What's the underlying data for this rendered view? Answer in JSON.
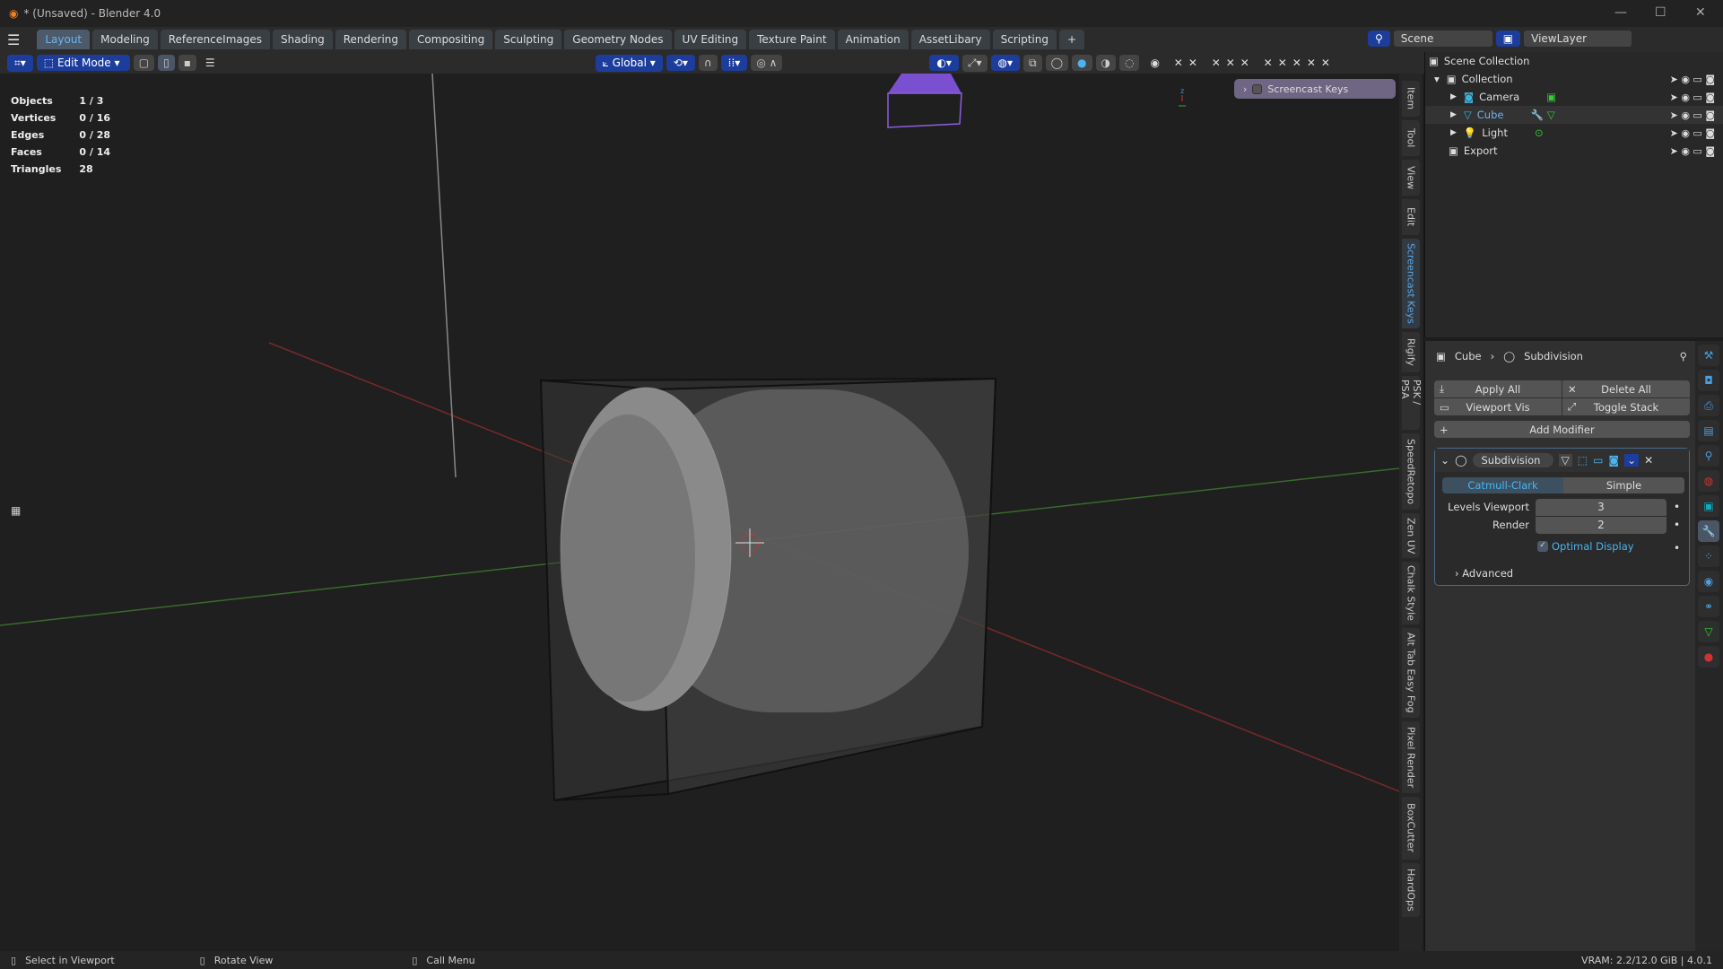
{
  "window": {
    "title": "* (Unsaved) - Blender 4.0",
    "controls": [
      "—",
      "☐",
      "✕"
    ]
  },
  "workspaces": {
    "tabs": [
      "Layout",
      "Modeling",
      "ReferenceImages",
      "Shading",
      "Rendering",
      "Compositing",
      "Sculpting",
      "Geometry Nodes",
      "UV Editing",
      "Texture Paint",
      "Animation",
      "AssetLibary",
      "Scripting"
    ],
    "active": "Layout",
    "add": "+"
  },
  "scene": {
    "scene_name": "Scene",
    "view_layer": "ViewLayer"
  },
  "viewport_header": {
    "mode": "Edit Mode",
    "transform_orientation": "Global"
  },
  "stats": [
    {
      "label": "Objects",
      "value": "1 / 3"
    },
    {
      "label": "Vertices",
      "value": "0 / 16"
    },
    {
      "label": "Edges",
      "value": "0 / 28"
    },
    {
      "label": "Faces",
      "value": "0 / 14"
    },
    {
      "label": "Triangles",
      "value": "28"
    }
  ],
  "screencast_keys": {
    "label": "Screencast Keys"
  },
  "side_tabs": [
    "Item",
    "Tool",
    "View",
    "Edit",
    "Screencast Keys",
    "Rigify",
    "PSK / PSA",
    "SpeedRetopo",
    "Zen UV",
    "Chalk Style",
    "Alt Tab Easy Fog",
    "Pixel Render",
    "BoxCutter",
    "HardOps"
  ],
  "side_tab_active": "Screencast Keys",
  "outliner": {
    "root": "Scene Collection",
    "items": [
      {
        "name": "Collection",
        "type": "collection"
      },
      {
        "name": "Camera",
        "type": "camera"
      },
      {
        "name": "Cube",
        "type": "mesh",
        "selected": true
      },
      {
        "name": "Light",
        "type": "light"
      },
      {
        "name": "Export",
        "type": "collection"
      }
    ]
  },
  "properties": {
    "breadcrumb": {
      "object": "Cube",
      "modifier": "Subdivision"
    },
    "buttons": {
      "apply_all": "Apply All",
      "delete_all": "Delete All",
      "viewport_vis": "Viewport Vis",
      "toggle_stack": "Toggle Stack",
      "add_modifier": "Add Modifier"
    },
    "modifier": {
      "name": "Subdivision",
      "types": [
        "Catmull-Clark",
        "Simple"
      ],
      "active_type": "Catmull-Clark",
      "levels_viewport_label": "Levels Viewport",
      "levels_viewport": "3",
      "render_label": "Render",
      "render": "2",
      "optimal_display_label": "Optimal Display",
      "optimal_display": true,
      "advanced": "Advanced"
    }
  },
  "statusbar": {
    "select": "Select in Viewport",
    "rotate": "Rotate View",
    "menu": "Call Menu",
    "info": "VRAM: 2.2/12.0 GiB | 4.0.1"
  },
  "colors": {
    "accent": "#4a9fe0",
    "active_blue": "#1d3d9c",
    "x_axis": "#8a2a2a",
    "y_axis": "#3a7a2a"
  }
}
